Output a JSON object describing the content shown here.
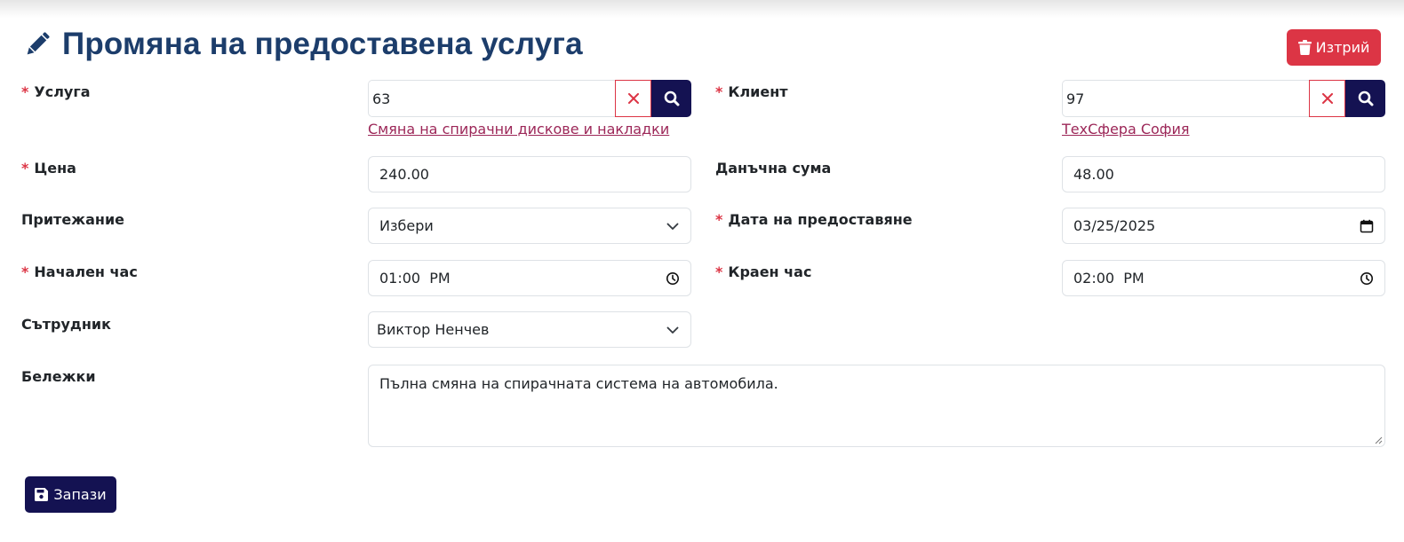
{
  "page": {
    "title": "Промяна на предоставена услуга",
    "title_icon": "pencil-icon",
    "delete_button": {
      "label": "Изтрий",
      "icon": "trash-icon",
      "color": "#dc3545"
    },
    "save_button": {
      "label": "Запази",
      "icon": "floppy-disk-icon",
      "color": "#141252"
    }
  },
  "colors": {
    "title": "#1c3d6b",
    "required": "#dc3545",
    "link": "#9c2758",
    "primary_dark": "#141252"
  },
  "form": {
    "service": {
      "label": "Услуга",
      "required": true,
      "value": "63",
      "link_text": "Смяна на спирачни дискове и накладки",
      "clear_icon": "close-icon",
      "search_icon": "search-icon"
    },
    "client": {
      "label": "Клиент",
      "required": true,
      "value": "97",
      "link_text": "ТехСфера София",
      "clear_icon": "close-icon",
      "search_icon": "search-icon"
    },
    "price": {
      "label": "Цена",
      "required": true,
      "value": "240.00"
    },
    "tax_amount": {
      "label": "Данъчна сума",
      "required": false,
      "value": "48.00"
    },
    "ownership": {
      "label": "Притежание",
      "required": false,
      "value": "Избери",
      "icon": "chevron-down-icon"
    },
    "service_date": {
      "label": "Дата на предоставяне",
      "required": true,
      "value": "03/25/2025",
      "icon": "calendar-icon"
    },
    "start_time": {
      "label": "Начален час",
      "required": true,
      "value": "01:00  PM",
      "icon": "clock-icon"
    },
    "end_time": {
      "label": "Краен час",
      "required": true,
      "value": "02:00  PM",
      "icon": "clock-icon"
    },
    "employee": {
      "label": "Сътрудник",
      "required": false,
      "value": "Виктор Ненчев",
      "icon": "chevron-down-icon"
    },
    "notes": {
      "label": "Бележки",
      "required": false,
      "value": "Пълна смяна на спирачната система на автомобила."
    }
  }
}
